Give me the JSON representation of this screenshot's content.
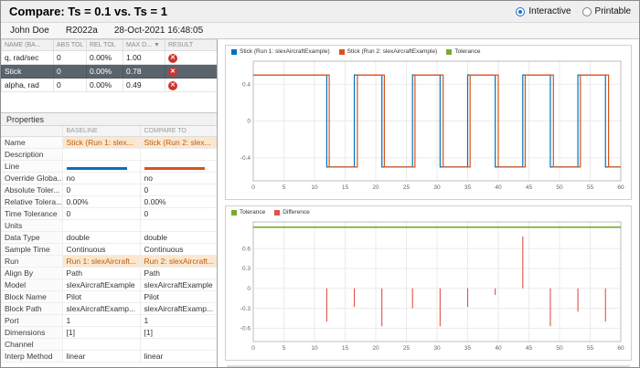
{
  "header": {
    "title": "Compare: Ts = 0.1 vs. Ts = 1",
    "user": "John Doe",
    "release": "R2022a",
    "timestamp": "28-Oct-2021 16:48:05",
    "view_options": [
      {
        "label": "Interactive",
        "selected": true
      },
      {
        "label": "Printable",
        "selected": false
      }
    ]
  },
  "icons": {
    "fail": "✕",
    "sort_desc": "▼"
  },
  "signals_table": {
    "columns": [
      {
        "key": "name",
        "label": "NAME (BA..."
      },
      {
        "key": "abs-tol",
        "label": "ABS TOL"
      },
      {
        "key": "rel-tol",
        "label": "REL TOL"
      },
      {
        "key": "max-diff",
        "label": "MAX D...",
        "sort": "▼"
      },
      {
        "key": "result",
        "label": "RESULT"
      }
    ],
    "rows": [
      {
        "name": "q, rad/sec",
        "abs_tol": "0",
        "rel_tol": "0.00%",
        "max_diff": "1.00",
        "result": "fail",
        "selected": false
      },
      {
        "name": "Stick",
        "abs_tol": "0",
        "rel_tol": "0.00%",
        "max_diff": "0.78",
        "result": "fail",
        "selected": true
      },
      {
        "name": "alpha, rad",
        "abs_tol": "0",
        "rel_tol": "0.00%",
        "max_diff": "0.49",
        "result": "fail",
        "selected": false
      }
    ]
  },
  "properties": {
    "title": "Properties",
    "columns": [
      "",
      "BASELINE",
      "COMPARE TO"
    ],
    "rows": [
      {
        "label": "Name",
        "baseline": "Stick (Run 1: slex...",
        "compare": "Stick (Run 2: slex...",
        "highlight": true
      },
      {
        "label": "Description",
        "baseline": "",
        "compare": ""
      },
      {
        "label": "Line",
        "type": "line",
        "baseline_color": "#0072BD",
        "compare_color": "#D95319",
        "baseline": "",
        "compare": ""
      },
      {
        "label": "Override Globa...",
        "baseline": "no",
        "compare": "no"
      },
      {
        "label": "Absolute Toler...",
        "baseline": "0",
        "compare": "0"
      },
      {
        "label": "Relative Tolera...",
        "baseline": "0.00%",
        "compare": "0.00%"
      },
      {
        "label": "Time Tolerance",
        "baseline": "0",
        "compare": "0"
      },
      {
        "label": "Units",
        "baseline": "",
        "compare": ""
      },
      {
        "label": "Data Type",
        "baseline": "double",
        "compare": "double"
      },
      {
        "label": "Sample Time",
        "baseline": "Continuous",
        "compare": "Continuous"
      },
      {
        "label": "Run",
        "baseline": "Run 1: slexAircraft...",
        "compare": "Run 2: slexAircraft...",
        "highlight": true
      },
      {
        "label": "Align By",
        "baseline": "Path",
        "compare": "Path"
      },
      {
        "label": "Model",
        "baseline": "slexAircraftExample",
        "compare": "slexAircraftExample"
      },
      {
        "label": "Block Name",
        "baseline": "Pilot",
        "compare": "Pilot"
      },
      {
        "label": "Block Path",
        "baseline": "slexAircraftExamp...",
        "compare": "slexAircraftExamp..."
      },
      {
        "label": "Port",
        "baseline": "1",
        "compare": "1"
      },
      {
        "label": "Dimensions",
        "baseline": "[1]",
        "compare": "[1]"
      },
      {
        "label": "Channel",
        "baseline": "",
        "compare": ""
      },
      {
        "label": "Interp Method",
        "baseline": "linear",
        "compare": "linear"
      }
    ]
  },
  "chart_data": [
    {
      "type": "line",
      "title": "Signal comparison",
      "legend": [
        {
          "label": "Stick (Run 1: slexAircraftExample)",
          "color": "#0072BD"
        },
        {
          "label": "Stick (Run 2: slexAircraftExample)",
          "color": "#D95319"
        },
        {
          "label": "Tolerance",
          "color": "#77AC30"
        }
      ],
      "xlim": [
        0,
        60
      ],
      "ylim": [
        -0.65,
        0.65
      ],
      "xticks": [
        0,
        5,
        10,
        15,
        20,
        25,
        30,
        35,
        40,
        45,
        50,
        55,
        60
      ],
      "yticks": [
        0.4,
        0,
        -0.4
      ],
      "grid": true,
      "series": [
        {
          "name": "Stick (Run 1: slexAircraftExample)",
          "color": "#0072BD",
          "kind": "square",
          "amplitude": 0.5,
          "transitions": [
            12,
            16.5,
            21,
            26,
            30.5,
            35,
            39.5,
            44,
            48.5,
            53,
            57.5
          ]
        },
        {
          "name": "Stick (Run 2: slexAircraftExample)",
          "color": "#D95319",
          "kind": "square",
          "amplitude": 0.5,
          "transitions": [
            12.4,
            17,
            21.4,
            26.4,
            31,
            35.4,
            40,
            44.4,
            49,
            53.4,
            58
          ]
        }
      ]
    },
    {
      "type": "line",
      "title": "Difference",
      "legend": [
        {
          "label": "Tolerance",
          "color": "#77AC30"
        },
        {
          "label": "Difference",
          "color": "#E2504A"
        }
      ],
      "xlim": [
        0,
        60
      ],
      "ylim": [
        -0.8,
        1.0
      ],
      "xticks": [
        0,
        5,
        10,
        15,
        20,
        25,
        30,
        35,
        40,
        45,
        50,
        55,
        60
      ],
      "yticks": [
        0.6,
        0.3,
        0,
        -0.3,
        -0.6
      ],
      "grid": true,
      "series": [
        {
          "name": "Tolerance",
          "color": "#77AC30",
          "kind": "hline",
          "y": 0.92
        },
        {
          "name": "Difference",
          "color": "#E2504A",
          "kind": "stem",
          "x": [
            12,
            16.5,
            21,
            26,
            30.5,
            35,
            39.5,
            44,
            48.5,
            53,
            57.5
          ],
          "y": [
            -0.5,
            -0.28,
            -0.57,
            -0.3,
            -0.57,
            -0.28,
            -0.1,
            0.78,
            -0.57,
            -0.35,
            -0.5
          ]
        }
      ]
    }
  ]
}
